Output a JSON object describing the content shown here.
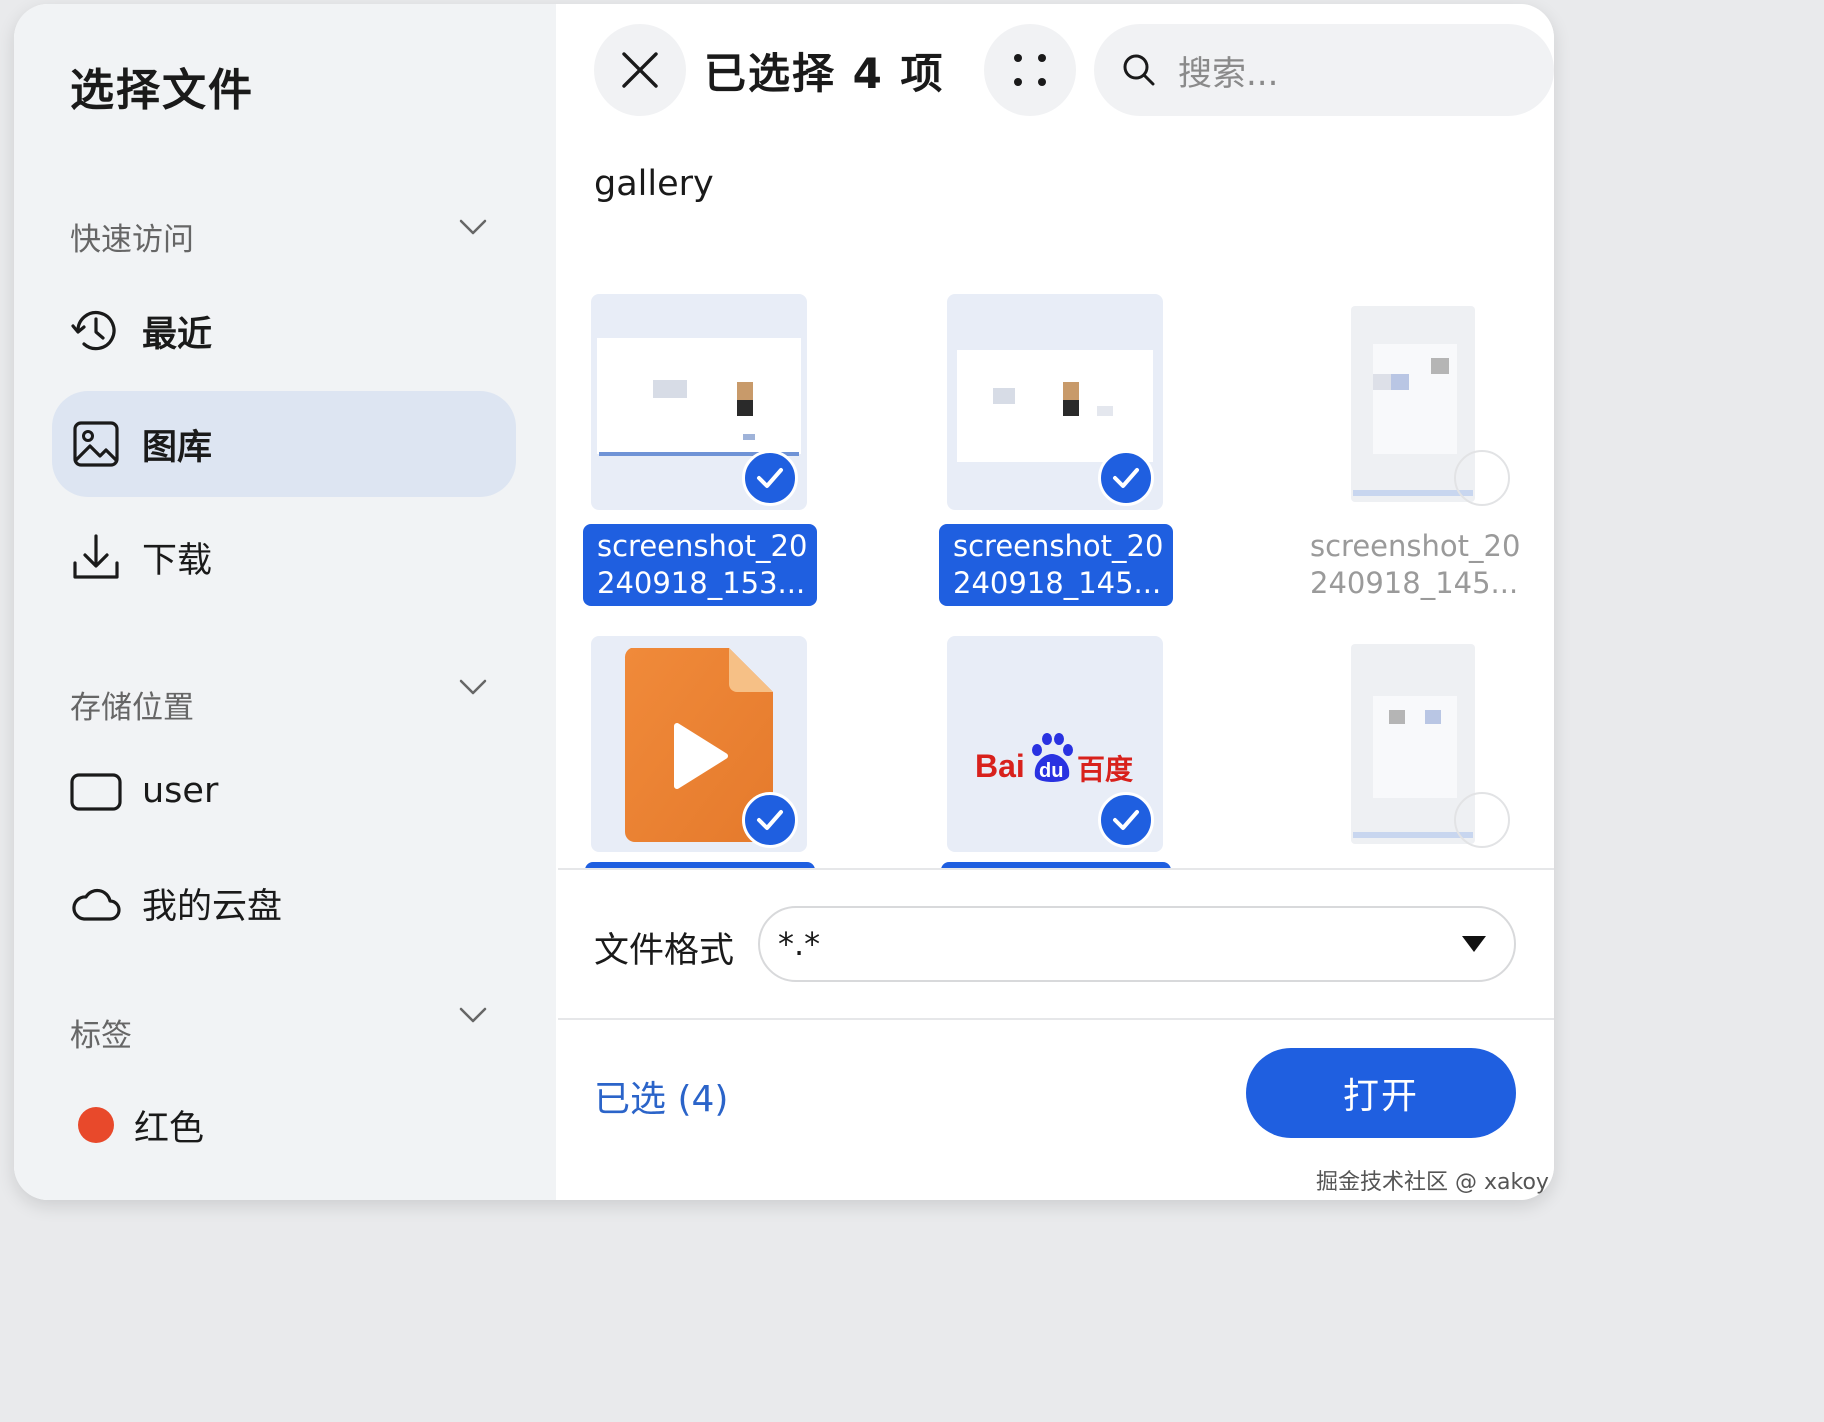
{
  "sidebar": {
    "title": "选择文件",
    "quick_access": {
      "header": "快速访问",
      "items": [
        {
          "label": "最近",
          "icon": "clock-icon"
        },
        {
          "label": "图库",
          "icon": "image-icon",
          "active": true
        },
        {
          "label": "下载",
          "icon": "download-icon"
        }
      ]
    },
    "storage": {
      "header": "存储位置",
      "items": [
        {
          "label": "user",
          "icon": "drive-icon"
        },
        {
          "label": "我的云盘",
          "icon": "cloud-icon"
        }
      ]
    },
    "tags": {
      "header": "标签",
      "items": [
        {
          "label": "红色",
          "color": "#e8492b"
        }
      ]
    }
  },
  "toolbar": {
    "selected_title": "已选择 4 项",
    "search_placeholder": "搜索..."
  },
  "folder": "gallery",
  "files": [
    {
      "line1": "screenshot_20",
      "line2": "240918_153...",
      "selected": true,
      "kind": "screenshot"
    },
    {
      "line1": "screenshot_20",
      "line2": "240918_145...",
      "selected": true,
      "kind": "screenshot"
    },
    {
      "line1": "screenshot_20",
      "line2": "240918_145...",
      "selected": false,
      "kind": "screenshot"
    },
    {
      "line1": "",
      "line2": "",
      "selected": true,
      "kind": "video"
    },
    {
      "line1": "",
      "line2": "",
      "selected": true,
      "kind": "baidu-logo"
    },
    {
      "line1": "",
      "line2": "",
      "selected": false,
      "kind": "screenshot"
    }
  ],
  "baidu_logo_text": {
    "left": "Bai",
    "middle": "du",
    "right": "百度"
  },
  "footer": {
    "format_label": "文件格式",
    "format_value": "*.*",
    "selected_count": "已选 (4)",
    "open_label": "打开"
  },
  "watermark": "掘金技术社区 @ xakoy",
  "colors": {
    "accent": "#1f5fe0",
    "sidebar_bg": "#f1f3f5",
    "active_item_bg": "#dde5f2",
    "tag_red": "#e8492b"
  }
}
